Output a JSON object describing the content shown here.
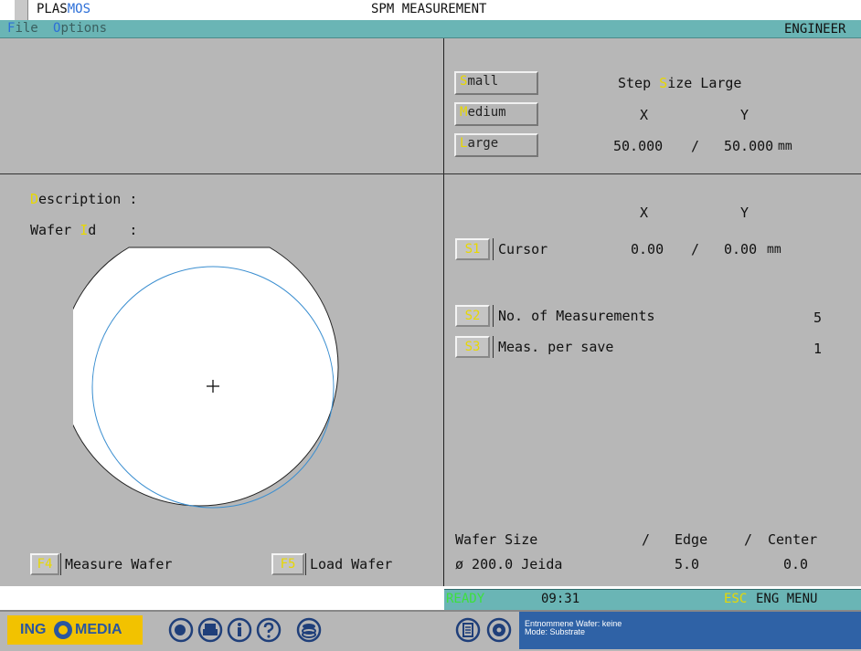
{
  "window": {
    "app_name_prefix": "PLAS",
    "app_name_suffix": "MOS",
    "title": "SPM MEASUREMENT"
  },
  "menubar": {
    "file_hotkey": "F",
    "file_rest": "ile",
    "options_hotkey": "O",
    "options_rest": "ptions",
    "user_level": "ENGINEER"
  },
  "step_size": {
    "buttons": [
      {
        "hotkey": "S",
        "rest": "mall"
      },
      {
        "hotkey": "M",
        "rest": "edium"
      },
      {
        "hotkey": "L",
        "rest": "arge"
      }
    ],
    "label_pre": "Step ",
    "label_hotkey": "S",
    "label_post": "ize Large",
    "x_header": "X",
    "y_header": "Y",
    "x_value": "50.000",
    "separator": "/",
    "y_value": "50.000",
    "unit": "mm"
  },
  "wafer_info": {
    "description_hotkey": "D",
    "description_rest": "escription :",
    "wafer_id_pre": "Wafer ",
    "wafer_id_hotkey": "I",
    "wafer_id_post": "d    :"
  },
  "cursor": {
    "x_header": "X",
    "y_header": "Y",
    "button": "S1",
    "label": "Cursor",
    "x_value": "0.00",
    "separator": "/",
    "y_value": "0.00",
    "unit": "mm"
  },
  "settings": [
    {
      "button": "S2",
      "label": "No. of Measurements",
      "value": "5"
    },
    {
      "button": "S3",
      "label": "Meas. per save",
      "value": "1"
    }
  ],
  "wafer_size": {
    "header_size": "Wafer Size",
    "sep1": "/",
    "header_edge": "Edge",
    "sep2": "/",
    "header_center": "Center",
    "size_value": "ø 200.0 Jeida",
    "edge_value": "5.0",
    "center_value": "0.0"
  },
  "function_keys": [
    {
      "key": "F4",
      "label": "Measure Wafer"
    },
    {
      "key": "F5",
      "label": "Load Wafer"
    }
  ],
  "statusbar": {
    "state": "READY",
    "time": "09:31",
    "esc_key": "ESC",
    "esc_label": "ENG MENU"
  },
  "taskbar": {
    "logo_pre": "ING",
    "logo_post": "MEDIA",
    "info_line1": "Entnommene Wafer: keine",
    "info_line2": "Mode: Substrate",
    "icons": [
      "record-icon",
      "printer-icon",
      "info-icon",
      "help-icon",
      "stack-icon",
      "document-icon",
      "gear-icon"
    ]
  },
  "colors": {
    "accent_yellow": "#e8d800",
    "accent_blue": "#2d6fd8",
    "teal_bar": "#6ab5b5",
    "panel_gray": "#b7b7b7",
    "ready_green": "#3de03d",
    "info_blue": "#2f62a6"
  }
}
